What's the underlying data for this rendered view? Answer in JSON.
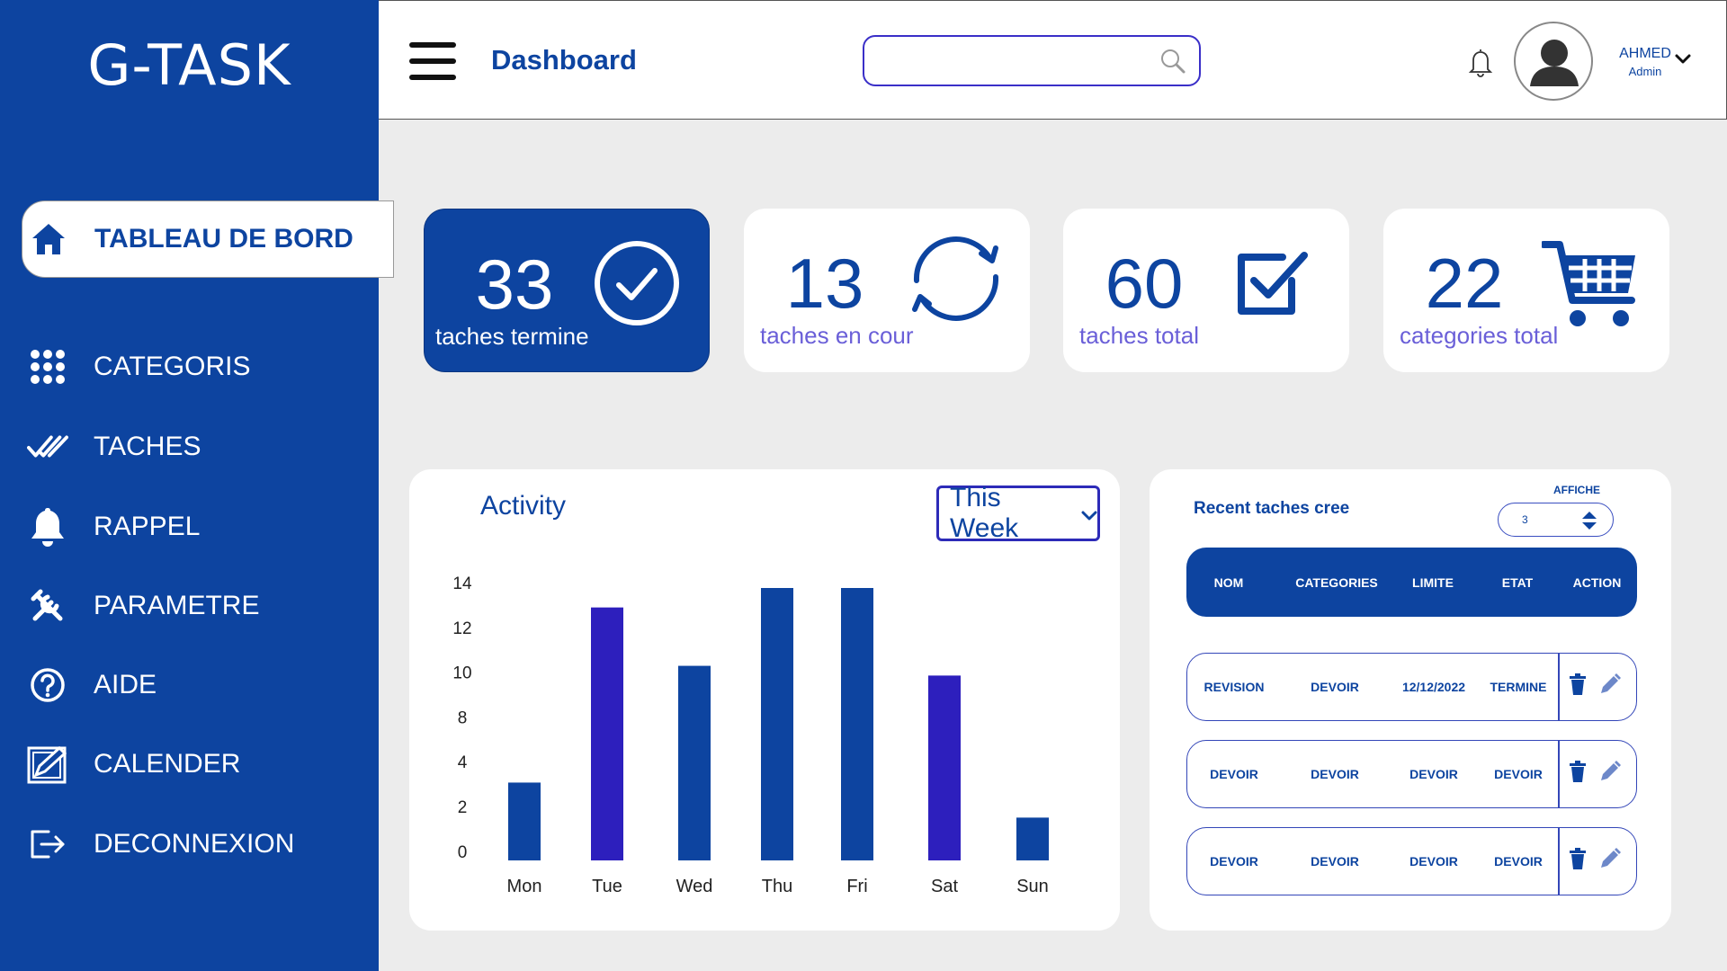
{
  "brand": "G-TASK",
  "sidebar": {
    "items": [
      {
        "label": "TABLEAU DE BORD",
        "icon": "home-icon"
      },
      {
        "label": "CATEGORIS",
        "icon": "grid-icon"
      },
      {
        "label": "TACHES",
        "icon": "double-check-icon"
      },
      {
        "label": "RAPPEL",
        "icon": "bell-icon"
      },
      {
        "label": "PARAMETRE",
        "icon": "tools-icon"
      },
      {
        "label": "AIDE",
        "icon": "help-icon"
      },
      {
        "label": "CALENDER",
        "icon": "calendar-edit-icon"
      },
      {
        "label": "DECONNEXION",
        "icon": "logout-icon"
      }
    ]
  },
  "header": {
    "title": "Dashboard",
    "search_placeholder": "",
    "user": {
      "name": "AHMED",
      "role": "Admin"
    }
  },
  "stats": [
    {
      "value": "33",
      "label": "taches termine",
      "icon": "check-circle-icon"
    },
    {
      "value": "13",
      "label": "taches en cour",
      "icon": "sync-icon"
    },
    {
      "value": "60",
      "label": "taches total",
      "icon": "checkbox-icon"
    },
    {
      "value": "22",
      "label": "categories total",
      "icon": "cart-icon"
    }
  ],
  "activity": {
    "title": "Activity",
    "period": "This Week"
  },
  "chart_data": {
    "type": "bar",
    "categories": [
      "Mon",
      "Tue",
      "Wed",
      "Thu",
      "Fri",
      "Sat",
      "Sun"
    ],
    "values": [
      4,
      13,
      10,
      14,
      14,
      9.5,
      2.2
    ],
    "yticks": [
      "14",
      "12",
      "10",
      "8",
      "4",
      "2",
      "0"
    ],
    "colors": [
      "#0d44a0",
      "#2d1fbd",
      "#0d44a0",
      "#0d44a0",
      "#0d44a0",
      "#2d1fbd",
      "#0d44a0"
    ],
    "title": "",
    "xlabel": "",
    "ylabel": "",
    "grid": false
  },
  "recent": {
    "title": "Recent taches cree",
    "affiche_label": "AFFICHE",
    "affiche_value": "3",
    "columns": [
      "NOM",
      "CATEGORIES",
      "LIMITE",
      "ETAT",
      "ACTION"
    ],
    "rows": [
      [
        "REVISION",
        "DEVOIR",
        "12/12/2022",
        "TERMINE"
      ],
      [
        "DEVOIR",
        "DEVOIR",
        "DEVOIR",
        "DEVOIR"
      ],
      [
        "DEVOIR",
        "DEVOIR",
        "DEVOIR",
        "DEVOIR"
      ]
    ]
  },
  "colors": {
    "primary": "#0d44a0",
    "accent": "#2d1fbd",
    "background": "#ececec"
  }
}
